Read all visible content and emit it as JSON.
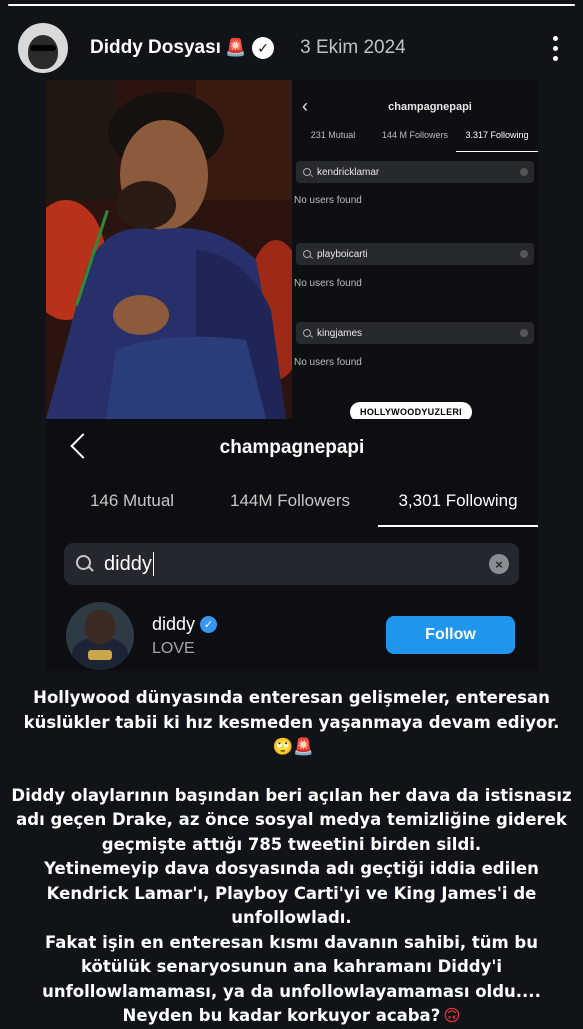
{
  "story": {
    "progress": 1.0
  },
  "header": {
    "username": "Diddy Dosyası",
    "siren": "🚨",
    "date": "3 Ekim 2024"
  },
  "screenshot_top": {
    "title": "champagnepapi",
    "tabs": [
      "231 Mutual",
      "144 M Followers",
      "3.317 Following"
    ],
    "searches": [
      {
        "query": "kendricklamar",
        "result": "No users found"
      },
      {
        "query": "playboicarti",
        "result": "No users found"
      },
      {
        "query": "kingjames",
        "result": "No users found"
      }
    ]
  },
  "watermark": "HOLLYWOODYUZLERI",
  "instagram": {
    "title": "champagnepapi",
    "tabs": [
      "146 Mutual",
      "144M Followers",
      "3,301 Following"
    ],
    "search_value": "diddy",
    "clear_icon": "×",
    "user": {
      "name": "diddy",
      "subtitle": "LOVE",
      "follow_label": "Follow"
    }
  },
  "caption": {
    "line1": "Hollywood dünyasında enteresan gelişmeler, enteresan küslükler tabii ki hız kesmeden yaşanmaya devam ediyor.",
    "line1_emojis": "🙄🚨",
    "paragraph2": "Diddy olaylarının başından beri açılan her dava da istisnasız adı geçen Drake, az önce sosyal medya temizliğine giderek geçmişte attığı 785 tweetini birden sildi.",
    "paragraph3": "Yetinemeyip dava dosyasında adı geçtiği iddia edilen Kendrick Lamar'ı, Playboy Carti'yi ve King James'i de unfollowladı.",
    "paragraph4": "Fakat işin en enteresan kısmı davanın sahibi, tüm bu kötülük senaryosunun ana kahramanı Diddy'i unfollowlamaması, ya da unfollowlayamaması oldu.... Neyden bu kadar korkuyor acaba?",
    "paragraph4_emoji": "🙃"
  },
  "icons": {
    "more": "more-vertical-icon",
    "verified": "verified-badge-icon",
    "back": "chevron-left-icon",
    "search": "search-icon"
  },
  "colors": {
    "background": "#101419",
    "follow": "#1f96ec",
    "verified": "#3897f0"
  }
}
